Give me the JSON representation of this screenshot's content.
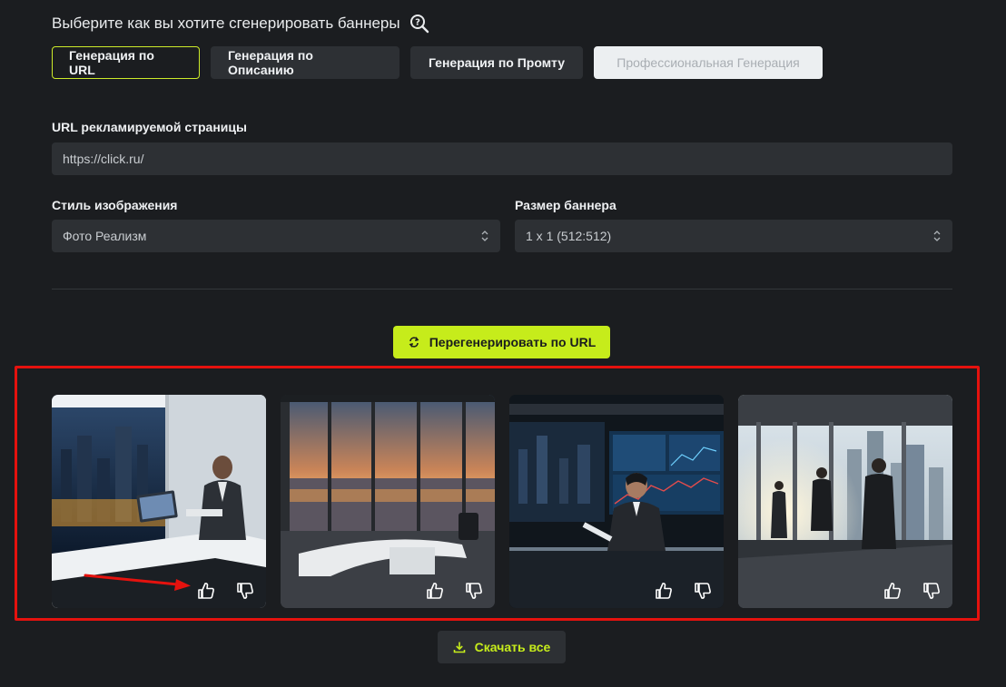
{
  "header": {
    "title": "Выберите как вы хотите сгенерировать баннеры",
    "help_icon": "search-help-icon"
  },
  "tabs": [
    {
      "label": "Генерация по URL",
      "state": "active"
    },
    {
      "label": "Генерация по Описанию",
      "state": "default"
    },
    {
      "label": "Генерация по Промту",
      "state": "default"
    },
    {
      "label": "Профессиональная Генерация",
      "state": "disabled"
    }
  ],
  "form": {
    "url_label": "URL рекламируемой страницы",
    "url_value": "https://click.ru/",
    "style_label": "Стиль изображения",
    "style_value": "Фото Реализм",
    "size_label": "Размер баннера",
    "size_value": "1 x 1 (512:512)"
  },
  "actions": {
    "regenerate_label": "Перегенерировать по URL",
    "regenerate_icon": "refresh-icon",
    "download_label": "Скачать все",
    "download_icon": "download-icon"
  },
  "banners": [
    {
      "scene": "businessman at laptop by night city window",
      "like_icon": "thumbs-up-icon",
      "dislike_icon": "thumbs-down-icon"
    },
    {
      "scene": "empty office with sunset city view",
      "like_icon": "thumbs-up-icon",
      "dislike_icon": "thumbs-down-icon"
    },
    {
      "scene": "businesswoman with tablet and data screens",
      "like_icon": "thumbs-up-icon",
      "dislike_icon": "thumbs-down-icon"
    },
    {
      "scene": "business people by skyscraper window",
      "like_icon": "thumbs-up-icon",
      "dislike_icon": "thumbs-down-icon"
    }
  ],
  "colors": {
    "background": "#1b1d20",
    "accent": "#c6ec1b",
    "field": "#2d3034",
    "highlight": "#e5120e"
  }
}
